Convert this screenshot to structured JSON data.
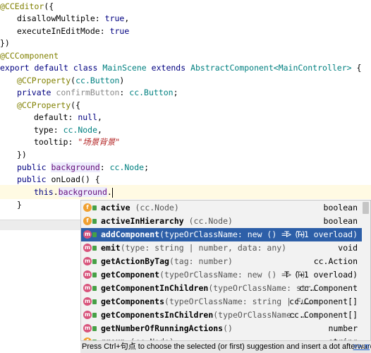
{
  "code": {
    "l1": {
      "decorator": "@CCEditor",
      "rest": "({"
    },
    "l2": {
      "key": "disallowMultiple",
      "sep": ": ",
      "val": "true",
      "end": ","
    },
    "l3": {
      "key": "executeInEditMode",
      "sep": ": ",
      "val": "true"
    },
    "l4": {
      "text": "})"
    },
    "l5": {
      "decorator": "@CCComponent"
    },
    "l6": {
      "kw1": "export default class",
      "cls": "MainScene",
      "kw2": "extends",
      "base": "AbstractComponent",
      "generic": "<MainController>",
      "end": " {"
    },
    "l7": {
      "decorator": "@CCProperty",
      "open": "(",
      "type": "cc.Button",
      "close": ")"
    },
    "l8": {
      "kw": "private",
      "name": "confirmButton",
      "sep": ": ",
      "type": "cc.Button",
      "end": ";"
    },
    "l9": {
      "decorator": "@CCProperty",
      "rest": "({"
    },
    "l10": {
      "key": "default",
      "sep": ": ",
      "val": "null",
      "end": ","
    },
    "l11": {
      "key": "type",
      "sep": ": ",
      "val": "cc.Node",
      "end": ","
    },
    "l12": {
      "key": "tooltip",
      "sep": ": ",
      "val": "\"场景背景\""
    },
    "l13": {
      "text": "})"
    },
    "l14": {
      "kw": "public",
      "name": "background",
      "sep": ": ",
      "type": "cc.Node",
      "end": ";"
    },
    "l15": {
      "kw": "public",
      "name": "onLoad",
      "end": "() {"
    },
    "l16": {
      "kw": "this",
      "dot": ".",
      "name": "background",
      "end": "."
    },
    "l17": {
      "text": "}"
    }
  },
  "completion": {
    "items": [
      {
        "icon": "f",
        "name": "active",
        "sig": " (cc.Node)",
        "ret": "boolean"
      },
      {
        "icon": "f",
        "name": "activeInHierarchy",
        "sig": " (cc.Node)",
        "ret": "boolean"
      },
      {
        "icon": "m",
        "name": "addComponent",
        "sig": "(typeOrClassName: new () => T)",
        "ret": "T (+1 overload)",
        "selected": true
      },
      {
        "icon": "m",
        "name": "emit",
        "sig": "(type: string | number, data: any)",
        "ret": "void"
      },
      {
        "icon": "m",
        "name": "getActionByTag",
        "sig": "(tag: number)",
        "ret": "cc.Action"
      },
      {
        "icon": "m",
        "name": "getComponent",
        "sig": "(typeOrClassName: new () => T)",
        "ret": "T (+1 overload)"
      },
      {
        "icon": "m",
        "name": "getComponentInChildren",
        "sig": "(typeOrClassName: str…",
        "ret": "cc.Component"
      },
      {
        "icon": "m",
        "name": "getComponents",
        "sig": "(typeOrClassName: string | Fu…",
        "ret": "cc.Component[]"
      },
      {
        "icon": "m",
        "name": "getComponentsInChildren",
        "sig": "(typeOrClassName: …",
        "ret": "cc.Component[]"
      },
      {
        "icon": "m",
        "name": "getNumberOfRunningActions",
        "sig": "()",
        "ret": "number"
      },
      {
        "icon": "f",
        "name": "group",
        "sig": " (cc.Node)",
        "ret": "string"
      }
    ],
    "status": "Press Ctrl+句点 to choose the selected (or first) suggestion and insert a dot afterwards",
    "more": ">> π"
  }
}
